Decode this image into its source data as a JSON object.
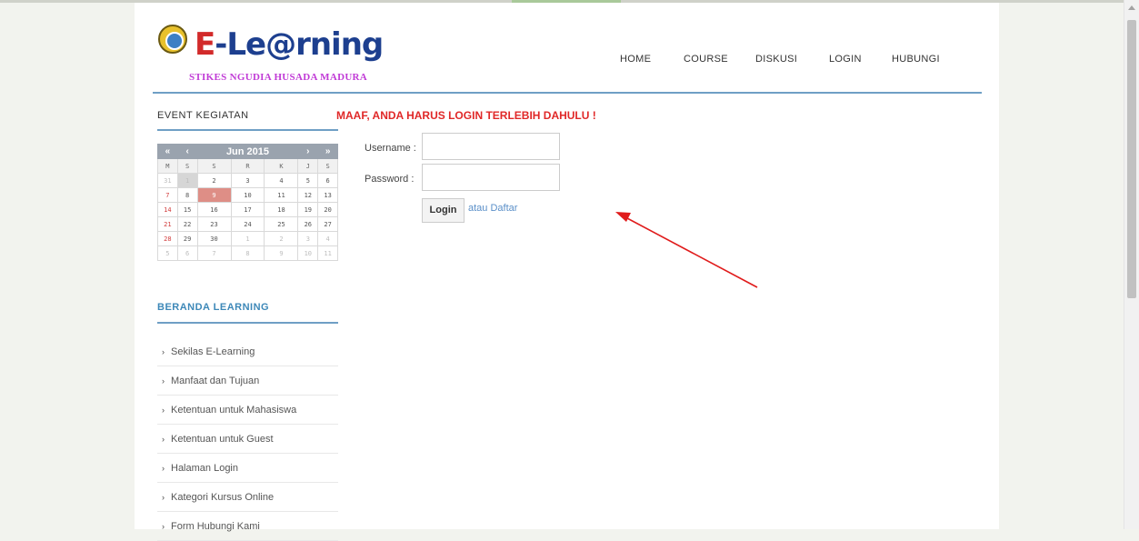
{
  "header": {
    "logo_title_prefix": "E",
    "logo_title_rest": "-Le@rning",
    "logo_subtitle": "STIKES NGUDIA HUSADA MADURA",
    "nav": [
      "HOME",
      "COURSE",
      "DISKUSI",
      "LOGIN",
      "HUBUNGI"
    ]
  },
  "sidebar": {
    "event_title": "EVENT KEGIATAN",
    "calendar": {
      "prev_year": "«",
      "prev_month": "‹",
      "month_label": "Jun 2015",
      "next_month": "›",
      "next_year": "»",
      "days": [
        "M",
        "S",
        "S",
        "R",
        "K",
        "J",
        "S"
      ],
      "weeks": [
        [
          "31",
          "1",
          "2",
          "3",
          "4",
          "5",
          "6"
        ],
        [
          "7",
          "8",
          "9",
          "10",
          "11",
          "12",
          "13"
        ],
        [
          "14",
          "15",
          "16",
          "17",
          "18",
          "19",
          "20"
        ],
        [
          "21",
          "22",
          "23",
          "24",
          "25",
          "26",
          "27"
        ],
        [
          "28",
          "29",
          "30",
          "1",
          "2",
          "3",
          "4"
        ],
        [
          "5",
          "6",
          "7",
          "8",
          "9",
          "10",
          "11"
        ]
      ],
      "today": "9",
      "selected": "1"
    },
    "beranda_title": "BERANDA LEARNING",
    "menu": [
      "Sekilas E-Learning",
      "Manfaat dan Tujuan",
      "Ketentuan untuk Mahasiswa",
      "Ketentuan untuk Guest",
      "Halaman Login",
      "Kategori Kursus Online",
      "Form Hubungi Kami"
    ]
  },
  "login": {
    "warning": "MAAF, ANDA HARUS LOGIN TERLEBIH DAHULU !",
    "username_label": "Username :",
    "password_label": "Password  :",
    "username_value": "",
    "password_value": "",
    "button_label": "Login",
    "register_link": "atau Daftar"
  },
  "colors": {
    "accent_rule": "#6f9fc5",
    "warning": "#e02828",
    "annotation_arrow": "#e01b1b"
  },
  "icons": {
    "menu_bullet": "chevron-right-icon",
    "annotation": "arrow-icon"
  }
}
